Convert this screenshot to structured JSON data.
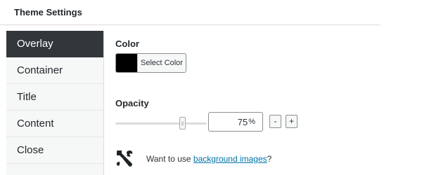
{
  "header": {
    "title": "Theme Settings"
  },
  "sidebar": {
    "items": [
      {
        "label": "Overlay",
        "active": true
      },
      {
        "label": "Container",
        "active": false
      },
      {
        "label": "Title",
        "active": false
      },
      {
        "label": "Content",
        "active": false
      },
      {
        "label": "Close",
        "active": false
      }
    ]
  },
  "color": {
    "label": "Color",
    "button_label": "Select Color",
    "value": "#000000"
  },
  "opacity": {
    "label": "Opacity",
    "value": "75",
    "unit": "%",
    "slider_fraction": 0.75,
    "decrement_label": "-",
    "increment_label": "+"
  },
  "tip": {
    "prefix": "Want to use ",
    "link_text": "background images",
    "suffix": "?",
    "icon": "tools-icon"
  },
  "colors": {
    "active_bg": "#32373c",
    "link": "#0073aa",
    "sidebar_bg": "#f6f7f7"
  }
}
